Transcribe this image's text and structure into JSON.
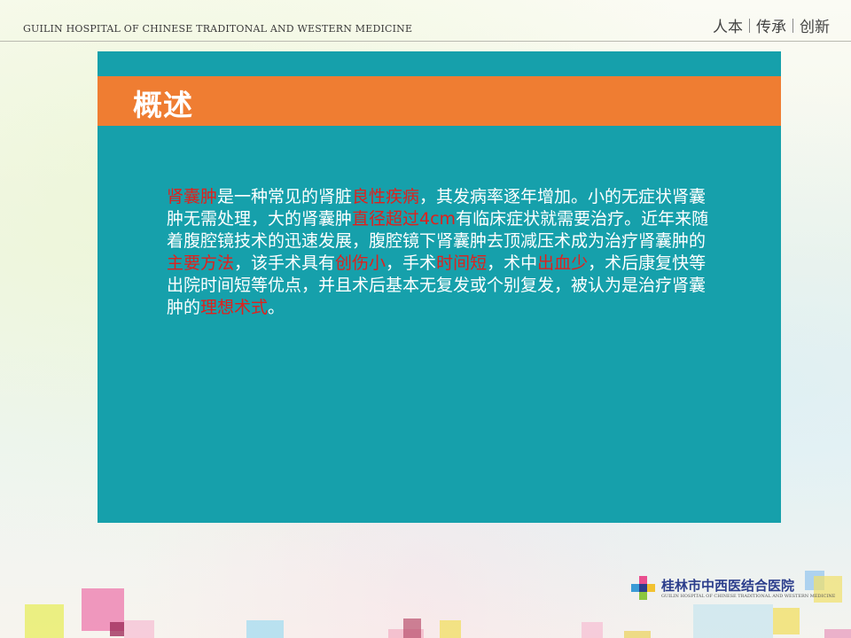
{
  "header": {
    "hospital_en": "GUILIN HOSPITAL OF CHINESE TRADITONAL AND WESTERN MEDICINE",
    "slogan": [
      "人本",
      "传承",
      "创新"
    ]
  },
  "slide": {
    "title": "概述",
    "body_segments": [
      {
        "text": "肾囊肿",
        "highlight": true
      },
      {
        "text": "是一种常见的肾脏",
        "highlight": false
      },
      {
        "text": "良性疾病",
        "highlight": true
      },
      {
        "text": "，其发病率逐年增加。小的无症状肾囊肿无需处理，大的肾囊肿",
        "highlight": false
      },
      {
        "text": "直径超过4cm",
        "highlight": true
      },
      {
        "text": "有临床症状就需要治疗。近年来随着腹腔镜技术的迅速发展，腹腔镜下肾囊肿去顶减压术成为治疗肾囊肿的",
        "highlight": false
      },
      {
        "text": "主要方法",
        "highlight": true
      },
      {
        "text": "，该手术具有",
        "highlight": false
      },
      {
        "text": "创伤小",
        "highlight": true
      },
      {
        "text": "，手术",
        "highlight": false
      },
      {
        "text": "时间短",
        "highlight": true
      },
      {
        "text": "，术中",
        "highlight": false
      },
      {
        "text": "出血少",
        "highlight": true
      },
      {
        "text": "，术后康复快等出院时间短等优点，并且术后基本无复发或个别复发，被认为是治疗肾囊肿的",
        "highlight": false
      },
      {
        "text": "理想术式",
        "highlight": true
      },
      {
        "text": "。",
        "highlight": false
      }
    ]
  },
  "footer": {
    "logo_cn": "桂林市中西医结合医院",
    "logo_en": "GUILIN HOSPITAL OF CHINESE TRADITIONAL AND WESTERN MEDICINE"
  },
  "colors": {
    "panel": "#16a0ab",
    "title_band": "#ef7d32",
    "highlight": "#e0201c"
  }
}
